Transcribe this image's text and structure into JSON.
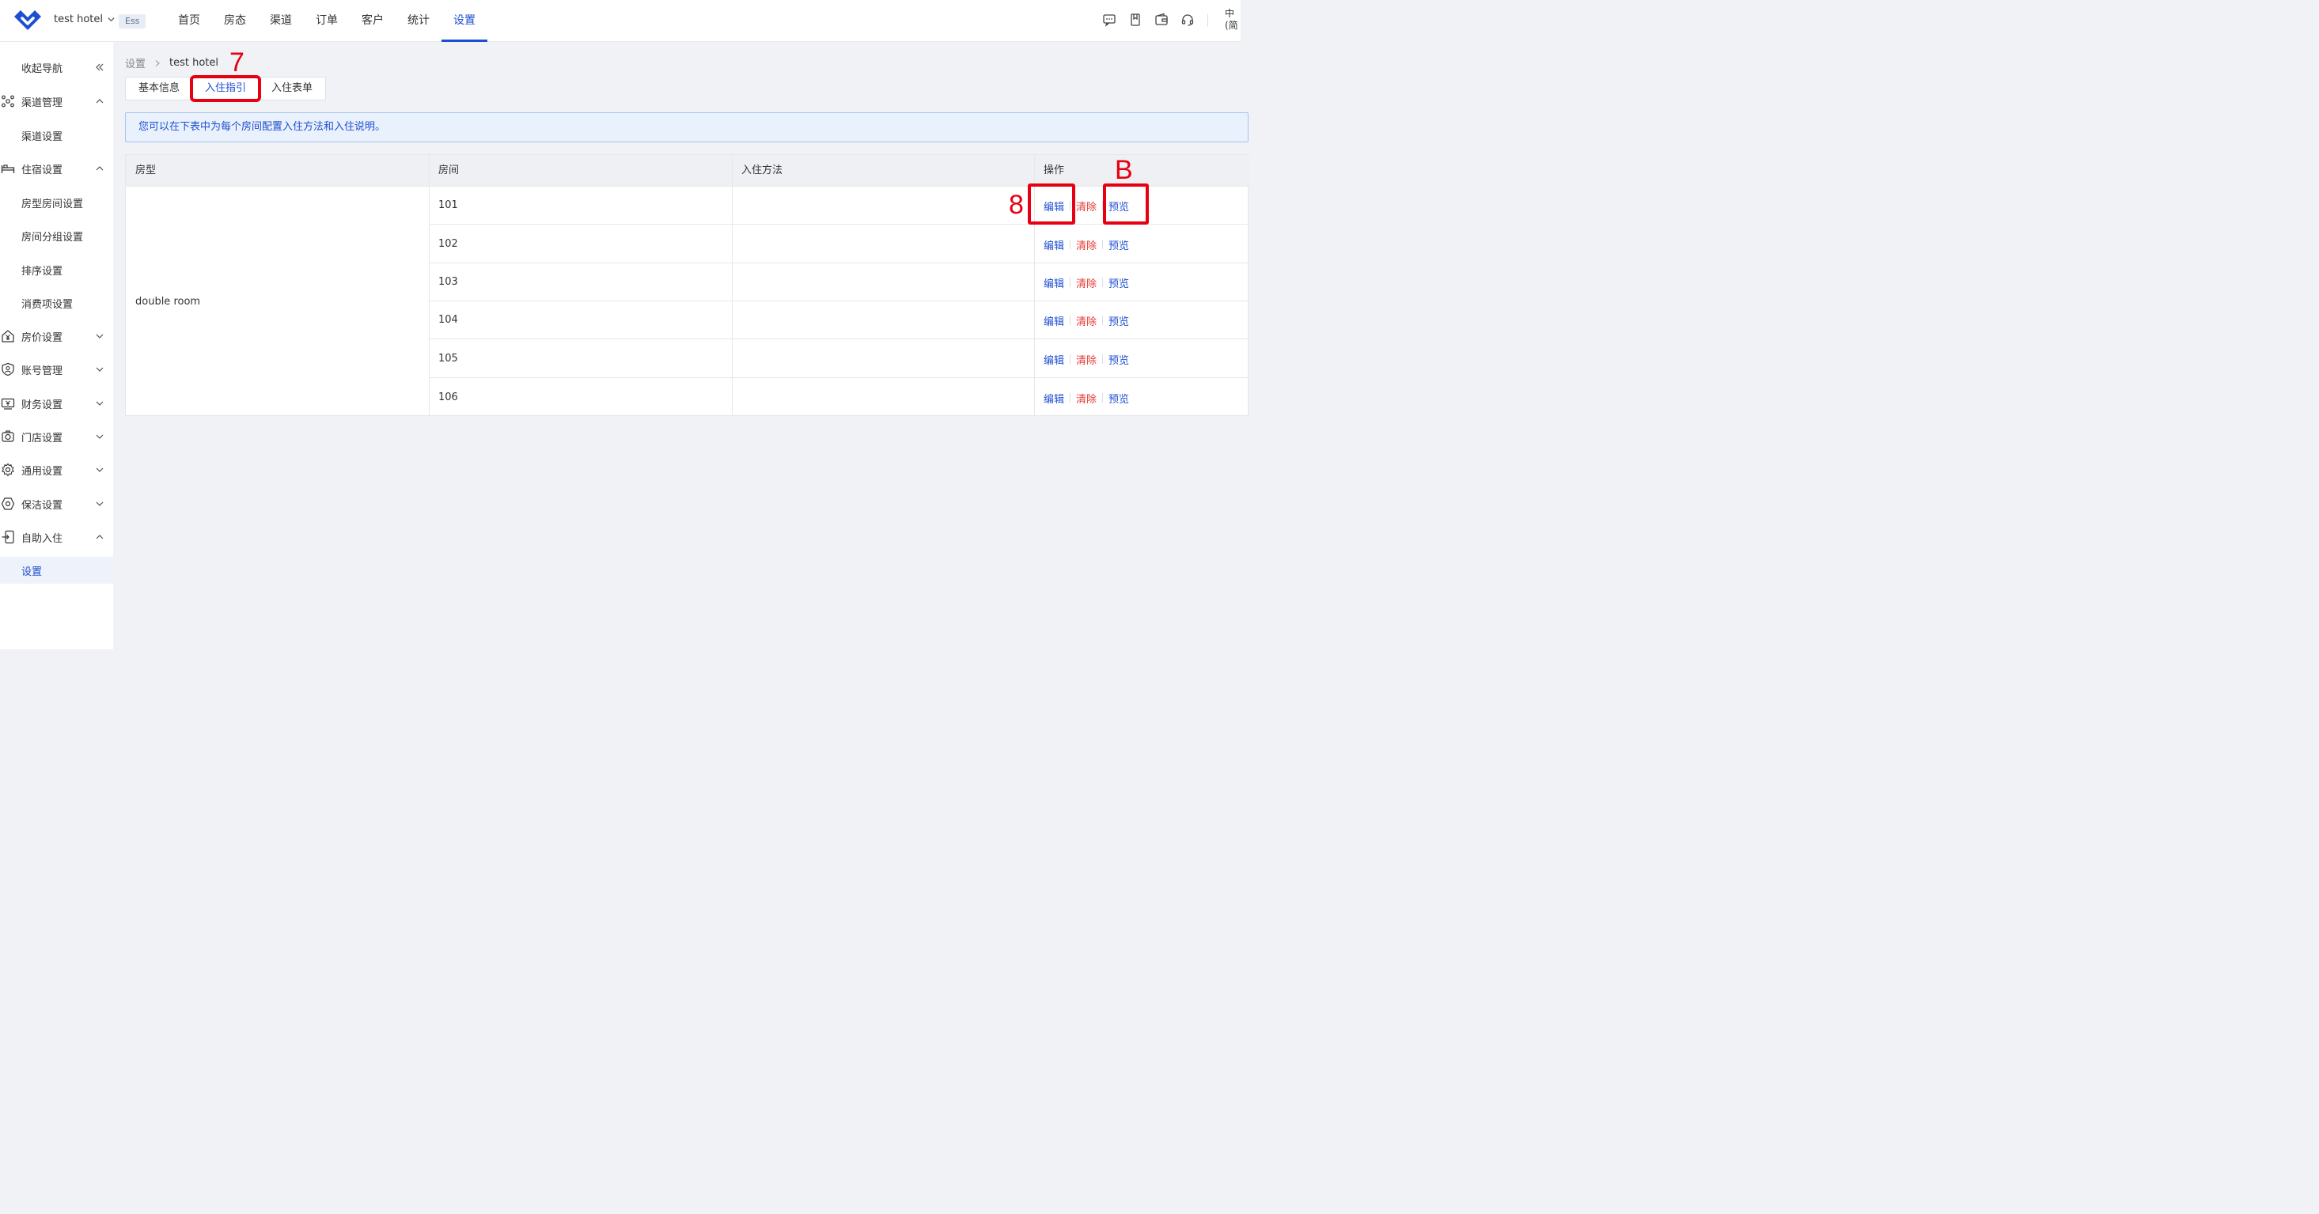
{
  "header": {
    "hotel_name": "test hotel",
    "badge": "Ess",
    "nav": [
      "首页",
      "房态",
      "渠道",
      "订单",
      "客户",
      "统计",
      "设置"
    ],
    "active_nav": "设置",
    "lang_line1": "中",
    "lang_line2": "(简"
  },
  "sidebar": {
    "collapse": "收起导航",
    "items": [
      {
        "label": "渠道管理"
      },
      {
        "label": "渠道设置"
      },
      {
        "label": "住宿设置"
      },
      {
        "label": "房型房间设置"
      },
      {
        "label": "房间分组设置"
      },
      {
        "label": "排序设置"
      },
      {
        "label": "消费项设置"
      },
      {
        "label": "房价设置"
      },
      {
        "label": "账号管理"
      },
      {
        "label": "财务设置"
      },
      {
        "label": "门店设置"
      },
      {
        "label": "通用设置"
      },
      {
        "label": "保洁设置"
      },
      {
        "label": "自助入住"
      },
      {
        "label": "设置"
      }
    ]
  },
  "breadcrumb": {
    "root": "设置",
    "current": "test hotel"
  },
  "tabs": [
    "基本信息",
    "入住指引",
    "入住表单"
  ],
  "active_tab": "入住指引",
  "alert": "您可以在下表中为每个房间配置入住方法和入住说明。",
  "table": {
    "headers": [
      "房型",
      "房间",
      "入住方法",
      "操作"
    ],
    "room_type": "double room",
    "rows": [
      {
        "room": "101",
        "method": ""
      },
      {
        "room": "102",
        "method": ""
      },
      {
        "room": "103",
        "method": ""
      },
      {
        "room": "104",
        "method": ""
      },
      {
        "room": "105",
        "method": ""
      },
      {
        "room": "106",
        "method": ""
      }
    ],
    "actions": {
      "edit": "编辑",
      "clear": "清除",
      "preview": "预览"
    }
  },
  "annotations": {
    "tab_mark": "7",
    "edit_mark": "8",
    "preview_mark": "B"
  },
  "colors": {
    "primary": "#1f4fd1",
    "danger": "#e53935",
    "annotation": "#e60012"
  }
}
